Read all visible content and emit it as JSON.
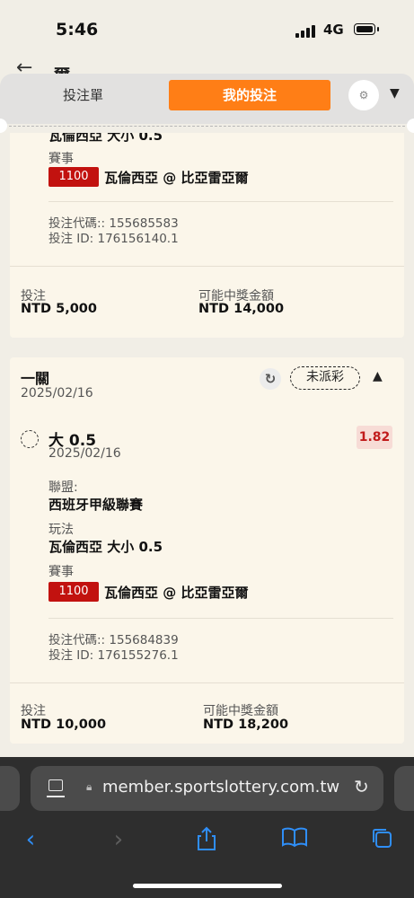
{
  "status_bar": {
    "time": "5:46",
    "network": "4G"
  },
  "page_behind": {
    "title_partial": "爾"
  },
  "bet_panel": {
    "tabs": {
      "bet_slip": "投注單",
      "my_bets": "我的投注"
    },
    "accent_color": "#ff7e16"
  },
  "bets": [
    {
      "play_value": "瓦倫西亞 大小 0.5",
      "match_label": "賽事",
      "match_code": "1100",
      "match_name": "瓦倫西亞 @ 比亞雷亞爾",
      "bet_code": "投注代碼:: 155685583",
      "bet_id": "投注 ID: 176156140.1",
      "stake_label": "投注",
      "stake_value": "NTD 5,000",
      "win_label": "可能中獎金額",
      "win_value": "NTD 14,000"
    },
    {
      "type": "一關",
      "date": "2025/02/16",
      "status": "未派彩",
      "selection": "大 0.5",
      "selection_date": "2025/02/16",
      "odds": "1.82",
      "league_label": "聯盟:",
      "league_value": "西班牙甲級聯賽",
      "play_label": "玩法",
      "play_value": "瓦倫西亞 大小 0.5",
      "match_label": "賽事",
      "match_code": "1100",
      "match_name": "瓦倫西亞 @ 比亞雷亞爾",
      "bet_code": "投注代碼:: 155684839",
      "bet_id": "投注 ID: 176155276.1",
      "stake_label": "投注",
      "stake_value": "NTD 10,000",
      "win_label": "可能中獎金額",
      "win_value": "NTD 18,200"
    }
  ],
  "browser": {
    "url": "member.sportslottery.com.tw",
    "toolbar_icons": [
      "back-icon",
      "forward-icon",
      "share-icon",
      "bookmarks-icon",
      "tabs-icon"
    ],
    "toolbar_color": "#2f8ef7"
  }
}
